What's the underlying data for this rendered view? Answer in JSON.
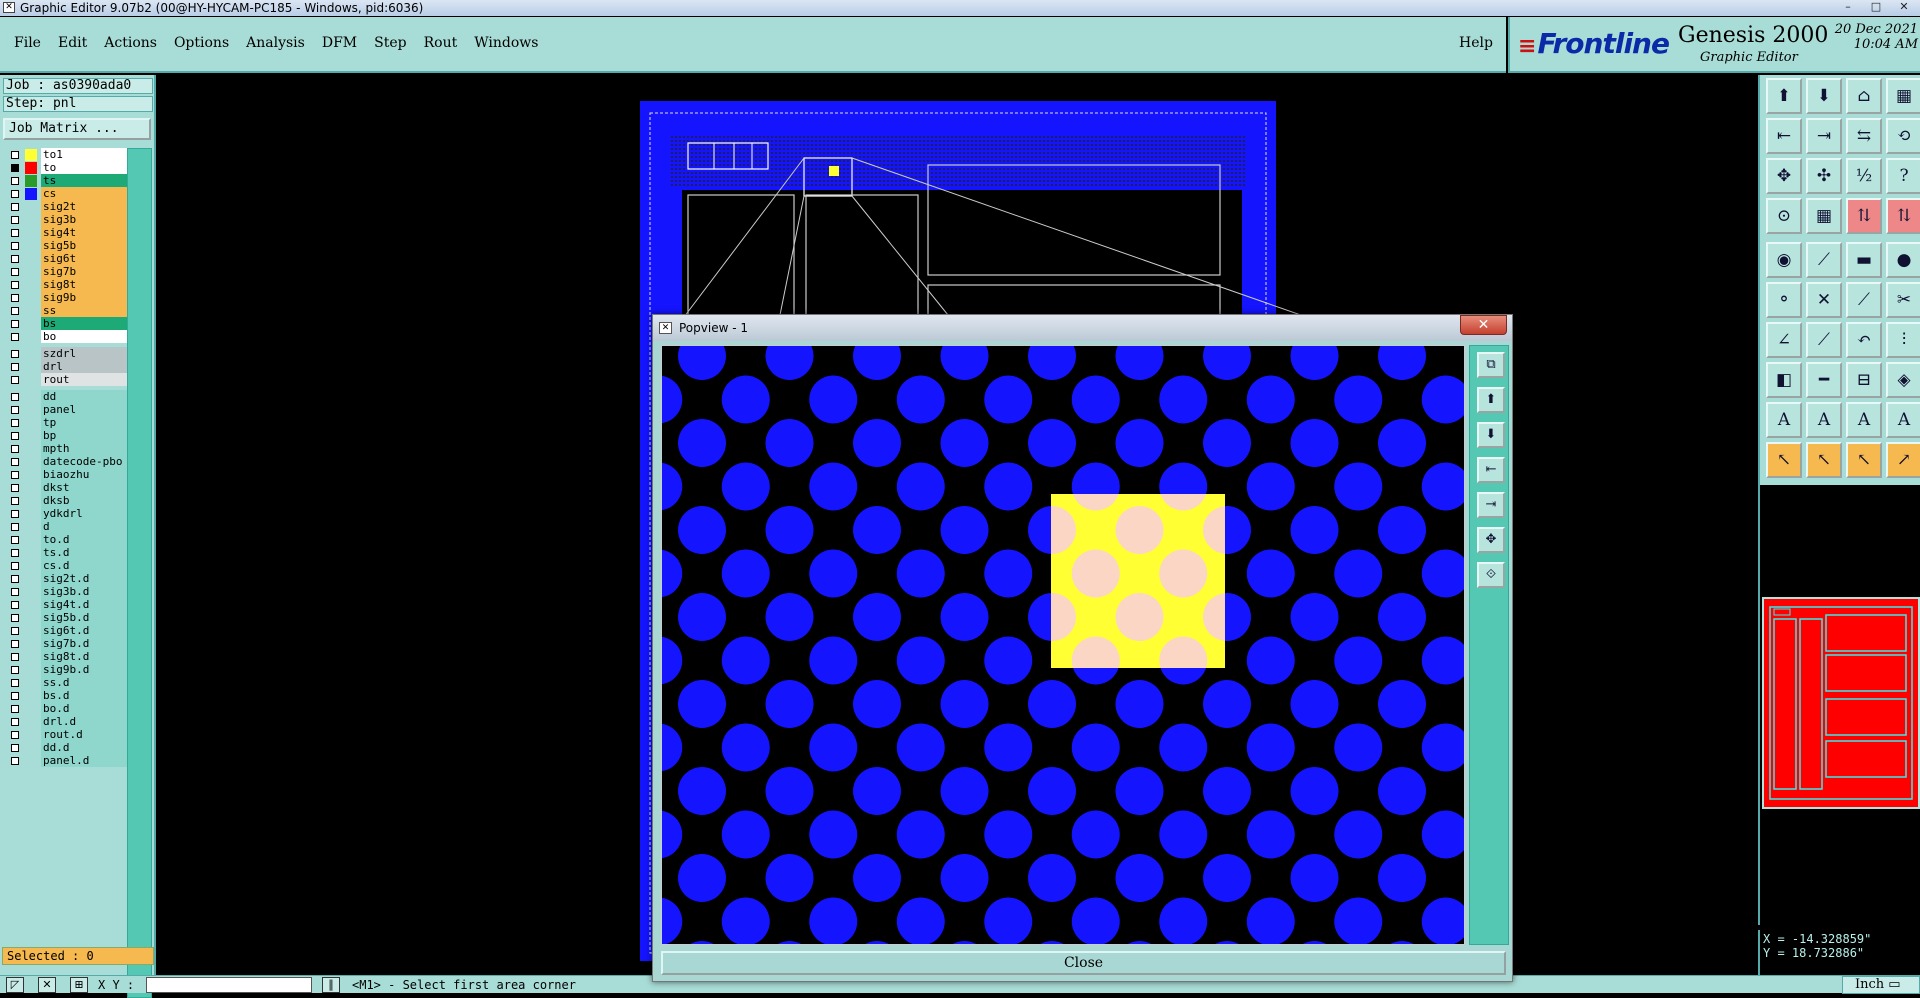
{
  "window": {
    "title": "Graphic Editor 9.07b2 (00@HY-HYCAM-PC185 - Windows, pid:6036)",
    "buttons": [
      "–",
      "□",
      "✕"
    ]
  },
  "menu": {
    "items": [
      "File",
      "Edit",
      "Actions",
      "Options",
      "Analysis",
      "DFM",
      "Step",
      "Rout",
      "Windows"
    ],
    "help": "Help"
  },
  "brand": {
    "logo": "Frontline",
    "product": "Genesis 2000",
    "subtitle": "Graphic Editor",
    "date": "20 Dec 2021",
    "time": "10:04 AM"
  },
  "job": {
    "job_label": "Job : as0390ada0",
    "step_label": "Step: pnl",
    "matrix_button": "Job Matrix ..."
  },
  "layers": [
    {
      "name": "to1",
      "swatch": "#ffff33",
      "bg": "#ffffff",
      "checked": false
    },
    {
      "name": "to",
      "swatch": "#ff0000",
      "bg": "#ffffff",
      "checked": true
    },
    {
      "name": "ts",
      "swatch": "#2a9a2a",
      "bg": "#1daa77",
      "checked": false
    },
    {
      "name": "cs",
      "swatch": "#1414ff",
      "bg": "#f6b94f",
      "checked": false
    },
    {
      "name": "sig2t",
      "swatch": "",
      "bg": "#f6b94f",
      "checked": false
    },
    {
      "name": "sig3b",
      "swatch": "",
      "bg": "#f6b94f",
      "checked": false
    },
    {
      "name": "sig4t",
      "swatch": "",
      "bg": "#f6b94f",
      "checked": false
    },
    {
      "name": "sig5b",
      "swatch": "",
      "bg": "#f6b94f",
      "checked": false
    },
    {
      "name": "sig6t",
      "swatch": "",
      "bg": "#f6b94f",
      "checked": false
    },
    {
      "name": "sig7b",
      "swatch": "",
      "bg": "#f6b94f",
      "checked": false
    },
    {
      "name": "sig8t",
      "swatch": "",
      "bg": "#f6b94f",
      "checked": false
    },
    {
      "name": "sig9b",
      "swatch": "",
      "bg": "#f6b94f",
      "checked": false
    },
    {
      "name": "ss",
      "swatch": "",
      "bg": "#f6b94f",
      "checked": false
    },
    {
      "name": "bs",
      "swatch": "",
      "bg": "#1daa77",
      "checked": false
    },
    {
      "name": "bo",
      "swatch": "",
      "bg": "#ffffff",
      "checked": false
    },
    {
      "name": "szdrl",
      "swatch": "",
      "bg": "#b9c4c7",
      "checked": false,
      "gap": true
    },
    {
      "name": "drl",
      "swatch": "",
      "bg": "#b9c4c7",
      "checked": false
    },
    {
      "name": "rout",
      "swatch": "",
      "bg": "#dfe3e3",
      "checked": false
    },
    {
      "name": "dd",
      "swatch": "",
      "bg": "#8fd6cc",
      "checked": false,
      "gap": true
    },
    {
      "name": "panel",
      "swatch": "",
      "bg": "#8fd6cc",
      "checked": false
    },
    {
      "name": "tp",
      "swatch": "",
      "bg": "#8fd6cc",
      "checked": false
    },
    {
      "name": "bp",
      "swatch": "",
      "bg": "#8fd6cc",
      "checked": false
    },
    {
      "name": "mpth",
      "swatch": "",
      "bg": "#8fd6cc",
      "checked": false
    },
    {
      "name": "datecode-pbo",
      "swatch": "",
      "bg": "#8fd6cc",
      "checked": false
    },
    {
      "name": "biaozhu",
      "swatch": "",
      "bg": "#8fd6cc",
      "checked": false
    },
    {
      "name": "dkst",
      "swatch": "",
      "bg": "#8fd6cc",
      "checked": false
    },
    {
      "name": "dksb",
      "swatch": "",
      "bg": "#8fd6cc",
      "checked": false
    },
    {
      "name": "ydkdrl",
      "swatch": "",
      "bg": "#8fd6cc",
      "checked": false
    },
    {
      "name": "d",
      "swatch": "",
      "bg": "#8fd6cc",
      "checked": false
    },
    {
      "name": "to.d",
      "swatch": "",
      "bg": "#8fd6cc",
      "checked": false
    },
    {
      "name": "ts.d",
      "swatch": "",
      "bg": "#8fd6cc",
      "checked": false
    },
    {
      "name": "cs.d",
      "swatch": "",
      "bg": "#8fd6cc",
      "checked": false
    },
    {
      "name": "sig2t.d",
      "swatch": "",
      "bg": "#8fd6cc",
      "checked": false
    },
    {
      "name": "sig3b.d",
      "swatch": "",
      "bg": "#8fd6cc",
      "checked": false
    },
    {
      "name": "sig4t.d",
      "swatch": "",
      "bg": "#8fd6cc",
      "checked": false
    },
    {
      "name": "sig5b.d",
      "swatch": "",
      "bg": "#8fd6cc",
      "checked": false
    },
    {
      "name": "sig6t.d",
      "swatch": "",
      "bg": "#8fd6cc",
      "checked": false
    },
    {
      "name": "sig7b.d",
      "swatch": "",
      "bg": "#8fd6cc",
      "checked": false
    },
    {
      "name": "sig8t.d",
      "swatch": "",
      "bg": "#8fd6cc",
      "checked": false
    },
    {
      "name": "sig9b.d",
      "swatch": "",
      "bg": "#8fd6cc",
      "checked": false
    },
    {
      "name": "ss.d",
      "swatch": "",
      "bg": "#8fd6cc",
      "checked": false
    },
    {
      "name": "bs.d",
      "swatch": "",
      "bg": "#8fd6cc",
      "checked": false
    },
    {
      "name": "bo.d",
      "swatch": "",
      "bg": "#8fd6cc",
      "checked": false
    },
    {
      "name": "drl.d",
      "swatch": "",
      "bg": "#8fd6cc",
      "checked": false
    },
    {
      "name": "rout.d",
      "swatch": "",
      "bg": "#8fd6cc",
      "checked": false
    },
    {
      "name": "dd.d",
      "swatch": "",
      "bg": "#8fd6cc",
      "checked": false
    },
    {
      "name": "panel.d",
      "swatch": "",
      "bg": "#8fd6cc",
      "checked": false
    }
  ],
  "selected": "Selected : 0",
  "bottom": {
    "xy_label": "X Y :",
    "xy_value": "",
    "status": "<M1> - Select first area corner",
    "units": "Inch"
  },
  "coords": {
    "x": "X = -14.328859\"",
    "y": "Y = 18.732886\""
  },
  "popview": {
    "title": "Popview - 1",
    "close_x": "✕",
    "close_button": "Close"
  },
  "colors": {
    "ui_bg": "#a8dcd6",
    "pad_blue": "#1414ff",
    "highlight_yellow": "#ffff33",
    "minimap_red": "#ff0000"
  },
  "toolbar_icons": [
    "open-job-icon",
    "save-icon",
    "home-icon",
    "grid-layout-icon",
    "step-left-icon",
    "step-right-icon",
    "flip-icon",
    "redraw-icon",
    "zoom-fit-icon",
    "zoom-home-icon",
    "scale-1-2-icon",
    "help-icon",
    "snap-icon",
    "grid-icon",
    "layers-compare-icon",
    "layers-edit-icon",
    "pad-icon",
    "line-edit-icon",
    "measure-icon",
    "circle-icon",
    "connect-icon",
    "cross-icon",
    "move-node-icon",
    "feature-pick-icon",
    "line-red-icon",
    "diagonal-icon",
    "arc-icon",
    "align-icon",
    "pad-move-icon",
    "line-cut-icon",
    "dimension-icon",
    "shapes-icon",
    "text-a-icon",
    "text-a-red-icon",
    "text-a-red2-icon",
    "text-a-blue-icon",
    "pointer-icon",
    "pointer-select-icon",
    "pointer-info-icon",
    "pointer-route-icon"
  ],
  "popview_tools": [
    "zoom-window-icon",
    "zoom-in-icon",
    "zoom-out-icon",
    "pan-left-icon",
    "pan-right-icon",
    "fit-all-icon",
    "center-icon"
  ]
}
